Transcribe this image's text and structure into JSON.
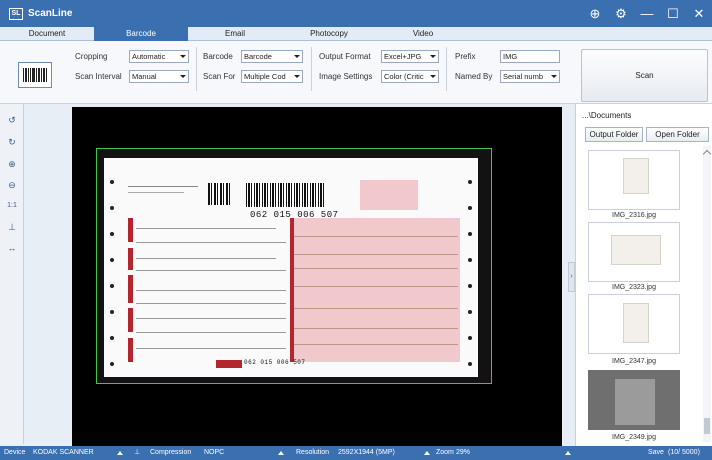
{
  "app": {
    "title": "ScanLine",
    "logo": "SL"
  },
  "window_controls": [
    {
      "name": "globe-icon",
      "glyph": "⊕"
    },
    {
      "name": "settings-icon",
      "glyph": "⚙"
    },
    {
      "name": "minimize-icon",
      "glyph": "—"
    },
    {
      "name": "maximize-icon",
      "glyph": "☐"
    },
    {
      "name": "close-icon",
      "glyph": "✕"
    }
  ],
  "tabs": [
    "Document",
    "Barcode",
    "Email",
    "Photocopy",
    "Video"
  ],
  "active_tab": "Barcode",
  "ribbon": {
    "cropping_label": "Cropping",
    "cropping_value": "Automatic",
    "scan_interval_label": "Scan Interval",
    "scan_interval_value": "Manual",
    "barcode_label": "Barcode",
    "barcode_value": "Barcode",
    "scan_for_label": "Scan For",
    "scan_for_value": "Multiple Cod",
    "output_format_label": "Output Format",
    "output_format_value": "Excel+JPG",
    "image_settings_label": "Image Settings",
    "image_settings_value": "Color (Critic",
    "prefix_label": "Prefix",
    "prefix_value": "IMG",
    "named_by_label": "Named By",
    "named_by_value": "Serial numb",
    "scan_button": "Scan"
  },
  "left_tools": [
    {
      "name": "rotate-left-icon",
      "glyph": "↺"
    },
    {
      "name": "rotate-right-icon",
      "glyph": "↻"
    },
    {
      "name": "zoom-in-icon",
      "glyph": "⊕"
    },
    {
      "name": "zoom-out-icon",
      "glyph": "⊖"
    },
    {
      "name": "actual-size-icon",
      "glyph": "1:1"
    },
    {
      "name": "stamp-icon",
      "glyph": "⊥"
    },
    {
      "name": "fit-width-icon",
      "glyph": "↔"
    }
  ],
  "document_preview": {
    "barcode_number": "062 015 006 507",
    "footer_number": "062 015 006 507"
  },
  "right_panel": {
    "path": "...\\Documents",
    "output_folder_button": "Output Folder",
    "open_folder_button": "Open Folder",
    "thumbnails": [
      {
        "name": "IMG_2316.jpg",
        "selected": false
      },
      {
        "name": "IMG_2323.jpg",
        "selected": false
      },
      {
        "name": "IMG_2347.jpg",
        "selected": false
      },
      {
        "name": "IMG_2349.jpg",
        "selected": true
      }
    ]
  },
  "status": {
    "device_label": "Device",
    "device_value": "KODAK SCANNER",
    "compression_label": "Compression",
    "compression_value": "NOPC",
    "resolution_label": "Resolution",
    "resolution_value": "2592X1944 (5MP)",
    "zoom_label": "Zoom",
    "zoom_value": "29%",
    "save_label": "Save",
    "save_value": "(10/ 5000)"
  },
  "colors": {
    "accent": "#3a6fb0",
    "crop_frame": "#47c24a",
    "form_pink": "#f1c9cd",
    "form_red": "#b3262e"
  }
}
